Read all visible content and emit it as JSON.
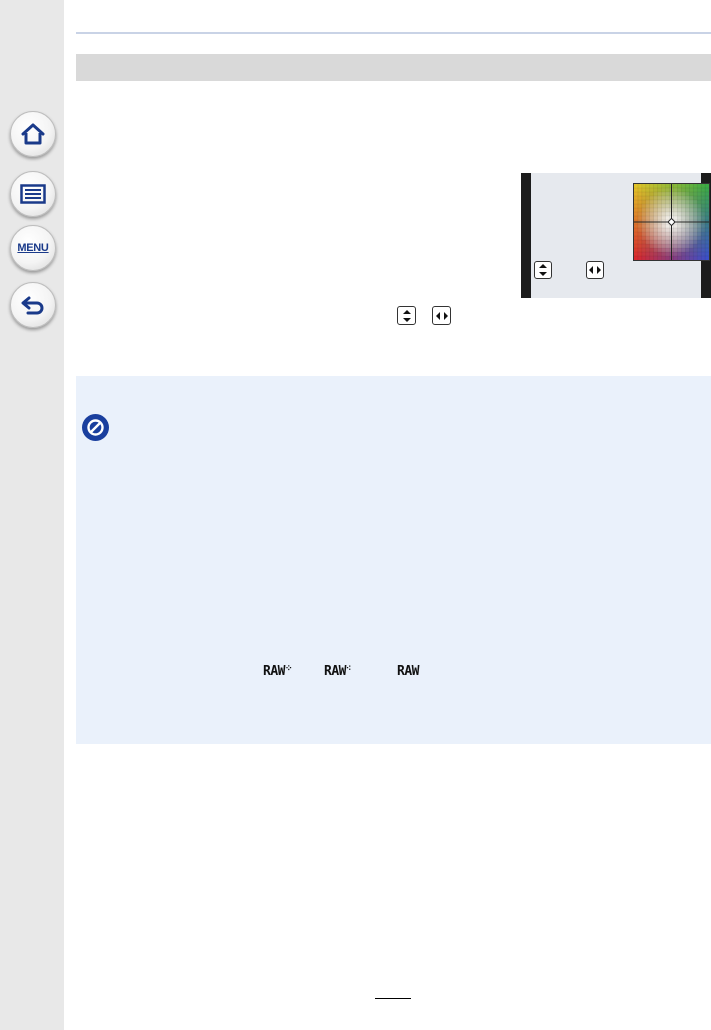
{
  "sidebar": {
    "buttons": [
      {
        "id": "home",
        "icon": "home-icon"
      },
      {
        "id": "contents",
        "icon": "list-icon"
      },
      {
        "id": "menu",
        "icon": "menu-icon",
        "label": "MENU"
      },
      {
        "id": "back",
        "icon": "back-arrow-icon"
      }
    ]
  },
  "camera_screen": {
    "icons": [
      "up-down-key-icon",
      "left-right-key-icon"
    ]
  },
  "instruction": {
    "icons": [
      "up-down-key-icon",
      "left-right-key-icon"
    ]
  },
  "note_panel": {
    "icon": "not-available-icon",
    "raw_badges": [
      {
        "text": "RAW",
        "suffix": "fine-icon"
      },
      {
        "text": "RAW",
        "suffix": "standard-icon"
      },
      {
        "text": "RAW"
      }
    ]
  },
  "colors": {
    "sidebar_bg": "#e8e8e8",
    "title_bar": "#d9d9d9",
    "note_bg": "#eaf1fb",
    "accent_blue": "#1a3f9e"
  }
}
